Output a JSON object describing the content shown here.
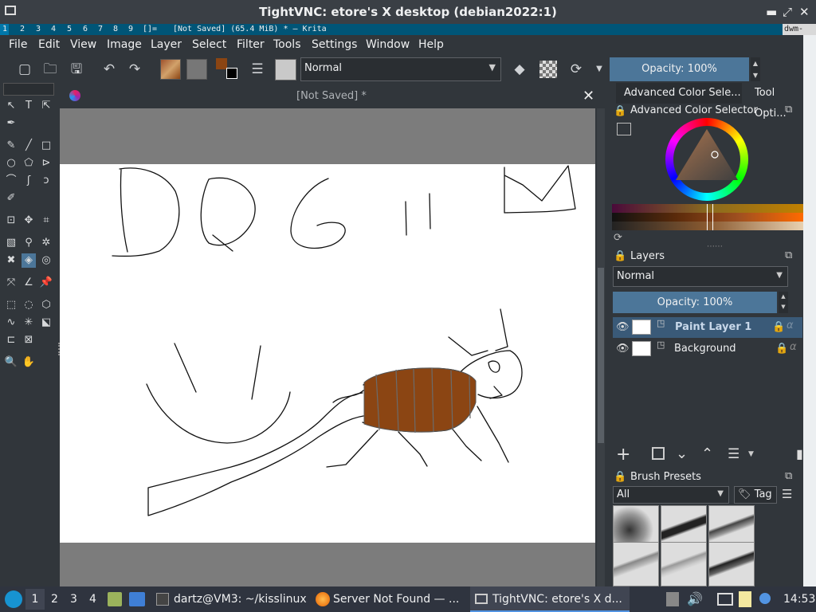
{
  "vnc": {
    "title": "TightVNC: etore's X desktop (debian2022:1)",
    "min": "▬",
    "max": "⤢",
    "close": "✕"
  },
  "dwm": {
    "tags": [
      "1",
      "2",
      "3",
      "4",
      "5",
      "6",
      "7",
      "8",
      "9"
    ],
    "layout": "[]=",
    "status": "[Not Saved]  (65.4 MiB)  * – Krita",
    "right": "dwm-"
  },
  "menu": [
    "File",
    "Edit",
    "View",
    "Image",
    "Layer",
    "Select",
    "Filter",
    "Tools",
    "Settings",
    "Window",
    "Help"
  ],
  "toolbar": {
    "blend_mode": "Normal",
    "opacity": "Opacity: 100%"
  },
  "document": {
    "title": "[Not Saved]  *"
  },
  "dock": {
    "tabs": [
      "Advanced Color Sele...",
      "Tool Opti..."
    ],
    "color_selector_title": "Advanced Color Selector",
    "layers_title": "Layers",
    "layers_blend": "Normal",
    "layers_opacity": "Opacity:  100%",
    "layers": [
      {
        "name": "Paint Layer 1",
        "selected": true
      },
      {
        "name": "Background",
        "selected": false
      }
    ],
    "brush_presets_title": "Brush Presets",
    "brush_filter": "All",
    "brush_tag": "Tag"
  },
  "taskbar": {
    "workspaces": [
      "1",
      "2",
      "3",
      "4"
    ],
    "tasks": [
      {
        "label": "dartz@VM3: ~/kisslinux"
      },
      {
        "label": "Server Not Found — ..."
      },
      {
        "label": "TightVNC: etore's X d..."
      }
    ],
    "clock": "14:53"
  },
  "colors": {
    "fill_brown": "#8b4513",
    "accent": "#4c7699",
    "selection": "#3a5a78"
  }
}
